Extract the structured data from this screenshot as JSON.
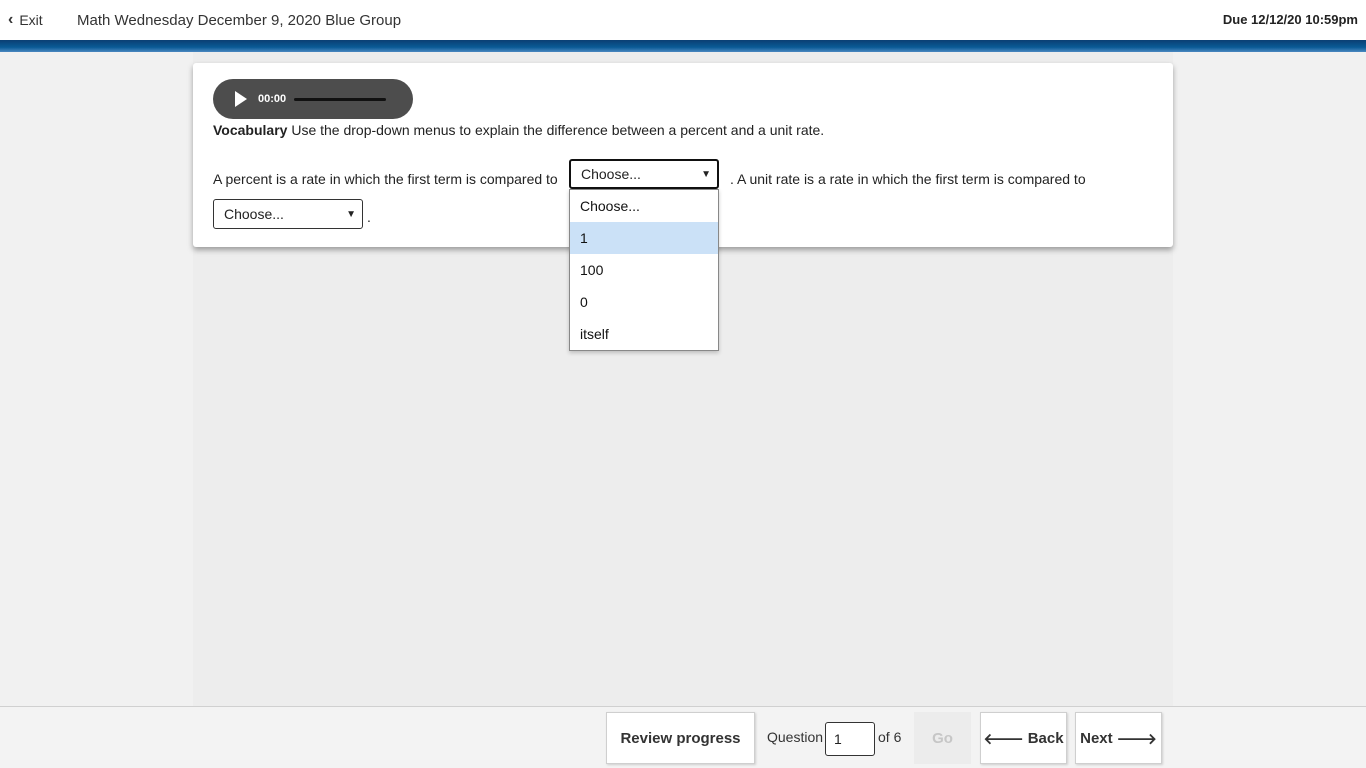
{
  "header": {
    "exit_label": "Exit",
    "title": "Math Wednesday December 9, 2020 Blue Group",
    "due": "Due 12/12/20 10:59pm"
  },
  "audio": {
    "time": "00:00"
  },
  "question": {
    "vocab_label": "Vocabulary",
    "instructions": " Use the drop-down menus to explain the difference between a percent and a unit rate.",
    "sentence1": "A percent is a rate in which the first term is compared to",
    "sentence2": ". A unit rate is a rate in which the first term is compared to",
    "period": ".",
    "select1_value": "Choose...",
    "select2_value": "Choose...",
    "dropdown_options": [
      "Choose...",
      "1",
      "100",
      "0",
      "itself"
    ],
    "highlighted_option": "1"
  },
  "footer": {
    "review_label": "Review progress",
    "question_label": "Question",
    "question_value": "1",
    "of_label": "of 6",
    "go_label": "Go",
    "back_label": "Back",
    "next_label": "Next"
  }
}
